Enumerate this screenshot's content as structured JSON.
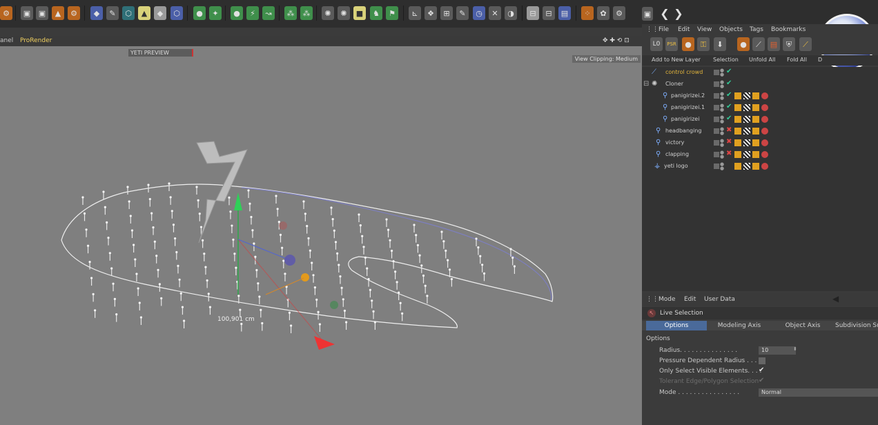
{
  "viewport": {
    "menu_left": "anel",
    "menu_prorender": "ProRender",
    "yeti_preview": "YETI PREVIEW",
    "view_clipping": "View Clipping: Medium",
    "measure_label": "100,901 cm"
  },
  "object_manager": {
    "menu": [
      "File",
      "Edit",
      "View",
      "Objects",
      "Tags",
      "Bookmarks"
    ],
    "filter_buttons": [
      "Add to New Layer",
      "Selection",
      "Unfold All",
      "Fold All",
      "D"
    ],
    "objects": [
      {
        "name": "control crowd",
        "highlight": true
      },
      {
        "name": "Cloner",
        "highlight": false
      },
      {
        "name": "panigirizei.2",
        "highlight": false
      },
      {
        "name": "panigirizei.1",
        "highlight": false
      },
      {
        "name": "panigirizei",
        "highlight": false
      },
      {
        "name": "headbanging",
        "highlight": false
      },
      {
        "name": "victory",
        "highlight": false
      },
      {
        "name": "clapping",
        "highlight": false
      },
      {
        "name": "yeti logo",
        "highlight": false
      }
    ],
    "iconbar_labels": {
      "lo": "L0",
      "psr": "PSR",
      "zero": "0"
    }
  },
  "attribute_manager": {
    "menu": [
      "Mode",
      "Edit",
      "User Data"
    ],
    "title": "Live Selection",
    "tabs": [
      "Options",
      "Modeling Axis",
      "Object Axis",
      "Subdivision Su"
    ],
    "section": "Options",
    "fields": {
      "radius_label": "Radius. . . . . . . . . . . . . . .",
      "radius_value": "10",
      "pressure_label": "Pressure Dependent Radius . . .",
      "only_visible_label": "Only Select Visible Elements. . . .",
      "tolerant_label": "Tolerant Edge/Polygon Selection",
      "mode_label": "Mode . . . . . . . . . . . . . . . .",
      "mode_value": "Normal"
    }
  },
  "colors": {
    "accent_orange": "#e0a020",
    "check_green": "#33cc99",
    "tag_red": "#cc3333"
  }
}
